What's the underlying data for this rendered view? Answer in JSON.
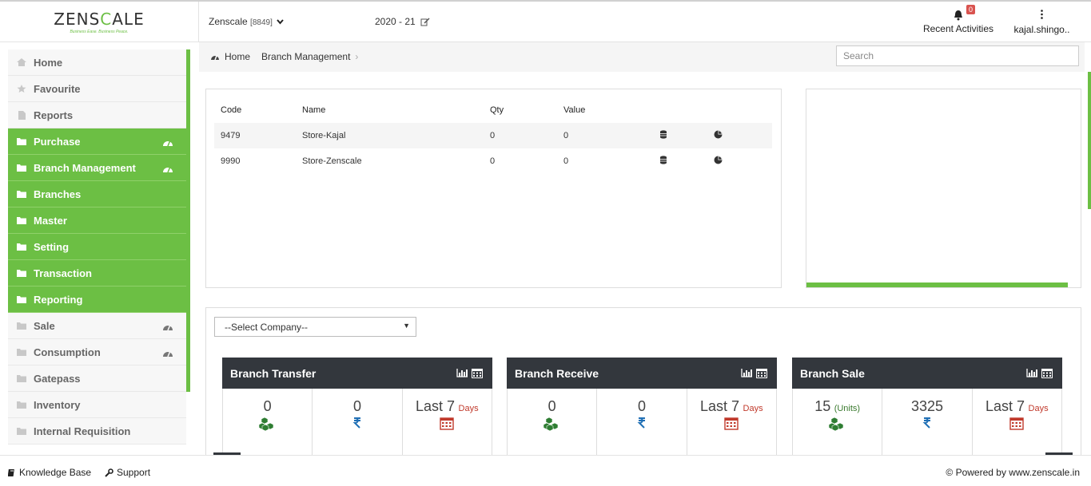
{
  "brand": {
    "logo_main": "ZENSCALE",
    "tagline": "Business Ease. Business Peace."
  },
  "header": {
    "company": "Zenscale",
    "company_code": "[8849]",
    "financial_year": "2020 - 21",
    "notification_count": "0",
    "recent_activities": "Recent Activities",
    "user": "kajal.shingo.."
  },
  "sidebar": {
    "items": [
      {
        "label": "Home",
        "icon": "home-icon",
        "style": "plain",
        "dash": false
      },
      {
        "label": "Favourite",
        "icon": "star-icon",
        "style": "plain",
        "dash": false
      },
      {
        "label": "Reports",
        "icon": "file-icon",
        "style": "plain",
        "dash": false
      },
      {
        "label": "Purchase",
        "icon": "folder-icon",
        "style": "green",
        "dash": true
      },
      {
        "label": "Branch Management",
        "icon": "folder-icon",
        "style": "green",
        "dash": true
      },
      {
        "label": "Branches",
        "icon": "folder-icon",
        "style": "green",
        "dash": false
      },
      {
        "label": "Master",
        "icon": "folder-icon",
        "style": "green",
        "dash": false
      },
      {
        "label": "Setting",
        "icon": "folder-icon",
        "style": "green",
        "dash": false
      },
      {
        "label": "Transaction",
        "icon": "folder-icon",
        "style": "green",
        "dash": false
      },
      {
        "label": "Reporting",
        "icon": "folder-icon",
        "style": "green",
        "dash": false
      },
      {
        "label": "Sale",
        "icon": "folder-icon",
        "style": "plain",
        "dash": true
      },
      {
        "label": "Consumption",
        "icon": "folder-icon",
        "style": "plain",
        "dash": true
      },
      {
        "label": "Gatepass",
        "icon": "folder-icon",
        "style": "plain",
        "dash": false
      },
      {
        "label": "Inventory",
        "icon": "folder-icon",
        "style": "plain",
        "dash": false
      },
      {
        "label": "Internal Requisition",
        "icon": "folder-icon",
        "style": "plain",
        "dash": false
      }
    ]
  },
  "breadcrumb": {
    "home": "Home",
    "current": "Branch Management"
  },
  "search": {
    "placeholder": "Search"
  },
  "stock_table": {
    "headers": [
      "Code",
      "Name",
      "Qty",
      "Value"
    ],
    "rows": [
      {
        "code": "9479",
        "name": "Store-Kajal",
        "qty": "0",
        "value": "0"
      },
      {
        "code": "9990",
        "name": "Store-Zenscale",
        "qty": "0",
        "value": "0"
      }
    ]
  },
  "company_dropdown": {
    "selected": "--Select Company--"
  },
  "cards": [
    {
      "title": "Branch Transfer",
      "qty": "0",
      "qty_unit": "",
      "amount": "0",
      "period_prefix": "Last 7",
      "period_unit": "Days"
    },
    {
      "title": "Branch Receive",
      "qty": "0",
      "qty_unit": "",
      "amount": "0",
      "period_prefix": "Last 7",
      "period_unit": "Days"
    },
    {
      "title": "Branch Sale",
      "qty": "15",
      "qty_unit": "(Units)",
      "amount": "3325",
      "period_prefix": "Last 7",
      "period_unit": "Days"
    }
  ],
  "footer": {
    "knowledge_base": "Knowledge Base",
    "support": "Support",
    "powered": "© Powered by www.zenscale.in"
  },
  "colors": {
    "accent": "#6cbf44",
    "dark": "#33373d",
    "rupee": "#1f6fb5",
    "calendar": "#c0392b"
  }
}
